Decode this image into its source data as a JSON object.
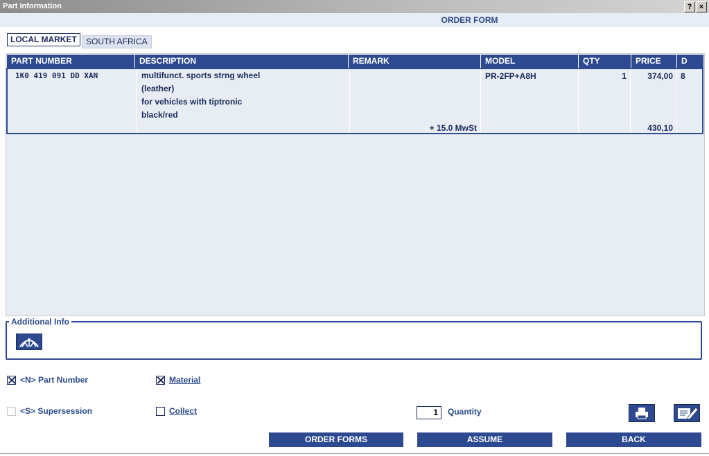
{
  "window": {
    "title": "Part Information",
    "help_btn": "?",
    "close_btn": "×"
  },
  "header": {
    "title": "ORDER FORM"
  },
  "tabs": [
    {
      "label": "LOCAL MARKET",
      "active": true
    },
    {
      "label": "SOUTH AFRICA",
      "active": false
    }
  ],
  "table": {
    "columns": [
      "PART NUMBER",
      "DESCRIPTION",
      "REMARK",
      "MODEL",
      "QTY",
      "PRICE",
      "D"
    ],
    "rows": [
      {
        "part_number": "1K0 419 091 DD XAN",
        "description": [
          "multifunct. sports strng wheel",
          "(leather)",
          "for vehicles with tiptronic",
          "black/red"
        ],
        "remark": "+ 15.0 MwSt",
        "model": "PR-2FP+A8H",
        "qty": "1",
        "price": "374,00",
        "price_incl": "430,10",
        "d": "8"
      }
    ]
  },
  "additional_info": {
    "label": "Additional Info",
    "icon": "steering-wheel-icon"
  },
  "options": {
    "part_number": {
      "label": "<N> Part Number",
      "checked": true
    },
    "material": {
      "label": "Material",
      "checked": true
    },
    "supersession": {
      "label": "<S> Supersession",
      "checked": false,
      "disabled": true
    },
    "collect": {
      "label": "Collect",
      "checked": false
    }
  },
  "quantity": {
    "value": "1",
    "label": "Quantity"
  },
  "buttons": {
    "order_forms": "ORDER FORMS",
    "assume": "ASSUME",
    "back": "BACK"
  },
  "colors": {
    "accent": "#2d4a91",
    "grid_bg": "#e8ecf3",
    "titlebar": "#8c8c8c"
  }
}
